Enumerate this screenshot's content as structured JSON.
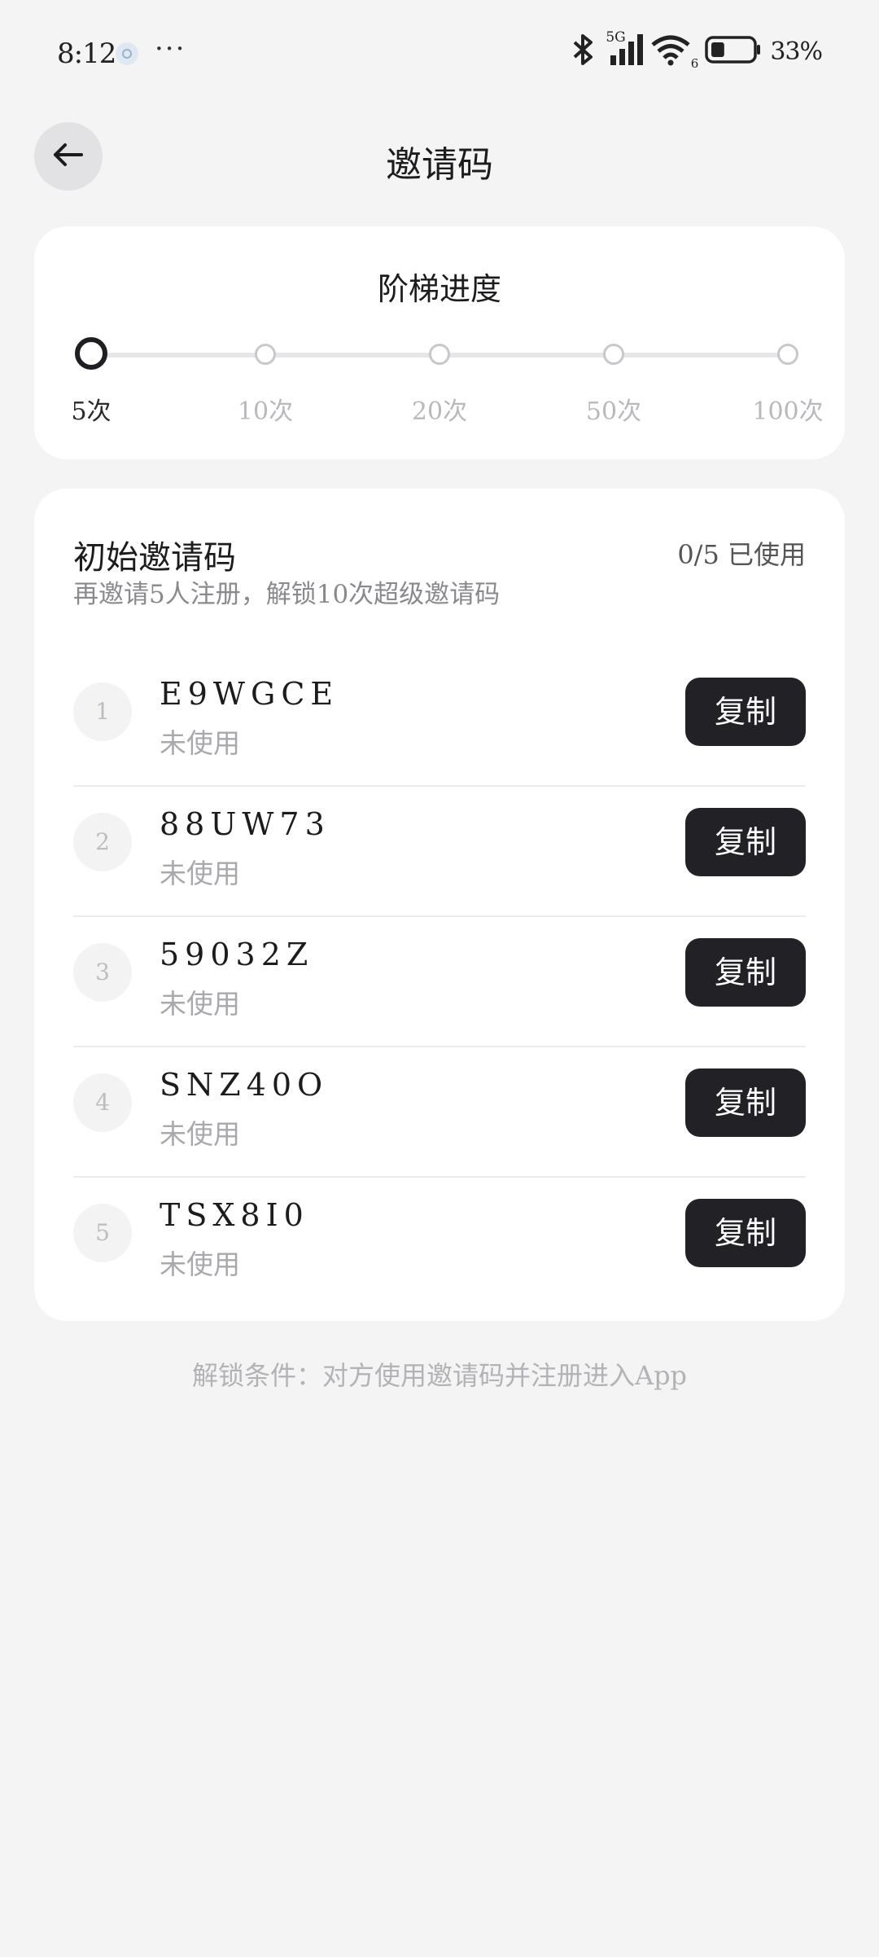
{
  "status_bar": {
    "time": "8:12",
    "dots": "···",
    "network_label": "5G",
    "wifi_label": "6",
    "battery_percent": "33%",
    "battery_level": 0.33,
    "icons": [
      "bluetooth-icon",
      "signal-icon",
      "wifi-icon",
      "battery-icon"
    ]
  },
  "header": {
    "back_icon": "arrow-left-icon",
    "title": "邀请码"
  },
  "progress": {
    "title": "阶梯进度",
    "steps": [
      {
        "label": "5次",
        "active": true
      },
      {
        "label": "10次",
        "active": false
      },
      {
        "label": "20次",
        "active": false
      },
      {
        "label": "50次",
        "active": false
      },
      {
        "label": "100次",
        "active": false
      }
    ]
  },
  "codes": {
    "title": "初始邀请码",
    "usage": "0/5 已使用",
    "subtitle": "再邀请5人注册，解锁10次超级邀请码",
    "copy_label": "复制",
    "items": [
      {
        "index": "1",
        "code": "E9WGCE",
        "status": "未使用"
      },
      {
        "index": "2",
        "code": "88UW73",
        "status": "未使用"
      },
      {
        "index": "3",
        "code": "59032Z",
        "status": "未使用"
      },
      {
        "index": "4",
        "code": "SNZ40O",
        "status": "未使用"
      },
      {
        "index": "5",
        "code": "TSX8I0",
        "status": "未使用"
      }
    ]
  },
  "footer_note": "解锁条件：对方使用邀请码并注册进入App",
  "colors": {
    "background": "#f4f4f4",
    "card": "#ffffff",
    "button": "#212126",
    "muted_text": "#a9a9ad"
  }
}
